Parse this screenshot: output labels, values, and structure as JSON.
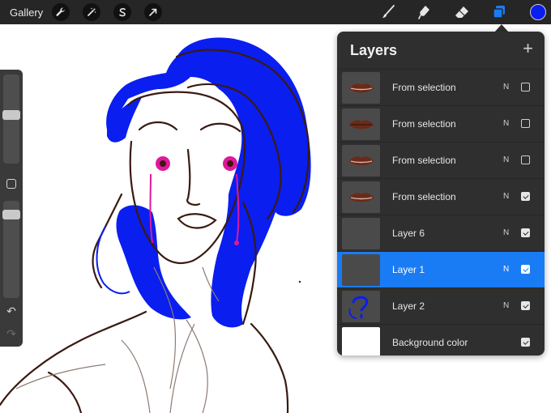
{
  "toolbar": {
    "gallery_label": "Gallery",
    "actions_icon": "wrench-icon",
    "adjustments_icon": "magic-wand-icon",
    "selection_icon": "selection-s-icon",
    "transform_icon": "arrow-cursor-icon",
    "brush_icon": "brush-icon",
    "smudge_icon": "smudge-icon",
    "eraser_icon": "eraser-icon",
    "layers_icon": "layers-icon",
    "current_color": "#0a1ef0"
  },
  "layers_panel": {
    "title": "Layers",
    "add_label": "+",
    "layers": [
      {
        "name": "From selection",
        "blend": "N",
        "visible": false,
        "selected": false
      },
      {
        "name": "From selection",
        "blend": "N",
        "visible": false,
        "selected": false
      },
      {
        "name": "From selection",
        "blend": "N",
        "visible": false,
        "selected": false
      },
      {
        "name": "From selection",
        "blend": "N",
        "visible": true,
        "selected": false
      },
      {
        "name": "Layer 6",
        "blend": "N",
        "visible": true,
        "selected": false
      },
      {
        "name": "Layer 1",
        "blend": "N",
        "visible": true,
        "selected": true
      },
      {
        "name": "Layer 2",
        "blend": "N",
        "visible": true,
        "selected": false
      },
      {
        "name": "Background color",
        "blend": "",
        "visible": true,
        "selected": false
      }
    ]
  },
  "sidebar": {
    "undo_icon": "undo-icon",
    "redo_icon": "redo-icon",
    "modify_icon": "square-modify-icon",
    "brush_size": 0.55,
    "opacity": 0.9
  },
  "colors": {
    "accent": "#1a7cf4",
    "hair_blue": "#0a1ef0",
    "eye_magenta": "#e0189a",
    "sketch_brown": "#3a1a12"
  }
}
